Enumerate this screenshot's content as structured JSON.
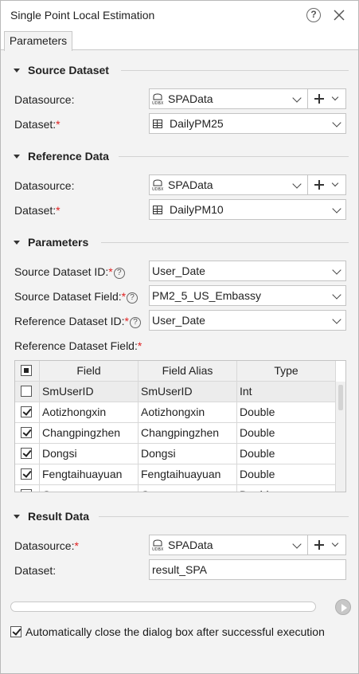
{
  "window": {
    "title": "Single Point Local Estimation"
  },
  "tabs": [
    {
      "label": "Parameters",
      "active": true
    }
  ],
  "sections": {
    "source": {
      "title": "Source Dataset"
    },
    "reference": {
      "title": "Reference Data"
    },
    "parameters": {
      "title": "Parameters"
    },
    "result": {
      "title": "Result Data"
    }
  },
  "source": {
    "datasource_label": "Datasource:",
    "datasource_value": "SPAData",
    "dataset_label": "Dataset:",
    "dataset_value": "DailyPM25"
  },
  "reference": {
    "datasource_label": "Datasource:",
    "datasource_value": "SPAData",
    "dataset_label": "Dataset:",
    "dataset_value": "DailyPM10"
  },
  "parameters": {
    "src_id_label": "Source Dataset ID:",
    "src_id_value": "User_Date",
    "src_field_label": "Source Dataset Field:",
    "src_field_value": "PM2_5_US_Embassy",
    "ref_id_label": "Reference Dataset ID:",
    "ref_id_value": "User_Date",
    "ref_field_label": "Reference Dataset Field:"
  },
  "grid": {
    "columns": [
      "Field",
      "Field Alias",
      "Type"
    ],
    "rows": [
      {
        "field": "SmUserID",
        "alias": "SmUserID",
        "type": "Int",
        "checked": false
      },
      {
        "field": "Aotizhongxin",
        "alias": "Aotizhongxin",
        "type": "Double",
        "checked": true
      },
      {
        "field": "Changpingzhen",
        "alias": "Changpingzhen",
        "type": "Double",
        "checked": true
      },
      {
        "field": "Dongsi",
        "alias": "Dongsi",
        "type": "Double",
        "checked": true
      },
      {
        "field": "Fengtaihuayuan",
        "alias": "Fengtaihuayuan",
        "type": "Double",
        "checked": true
      },
      {
        "field": "Guanyuan",
        "alias": "Guanyuan",
        "type": "Double",
        "checked": true
      }
    ]
  },
  "result": {
    "datasource_label": "Datasource:",
    "datasource_value": "SPAData",
    "dataset_label": "Dataset:",
    "dataset_value": "result_SPA"
  },
  "footer": {
    "progress": 0,
    "autoclose_label": "Automatically close the dialog box after successful execution",
    "autoclose_checked": true
  },
  "icons": {
    "help": "help-icon",
    "close": "close-icon",
    "datasource": "udb-datasource-icon",
    "dataset": "table-dataset-icon",
    "add": "plus-icon",
    "run": "play-icon"
  }
}
